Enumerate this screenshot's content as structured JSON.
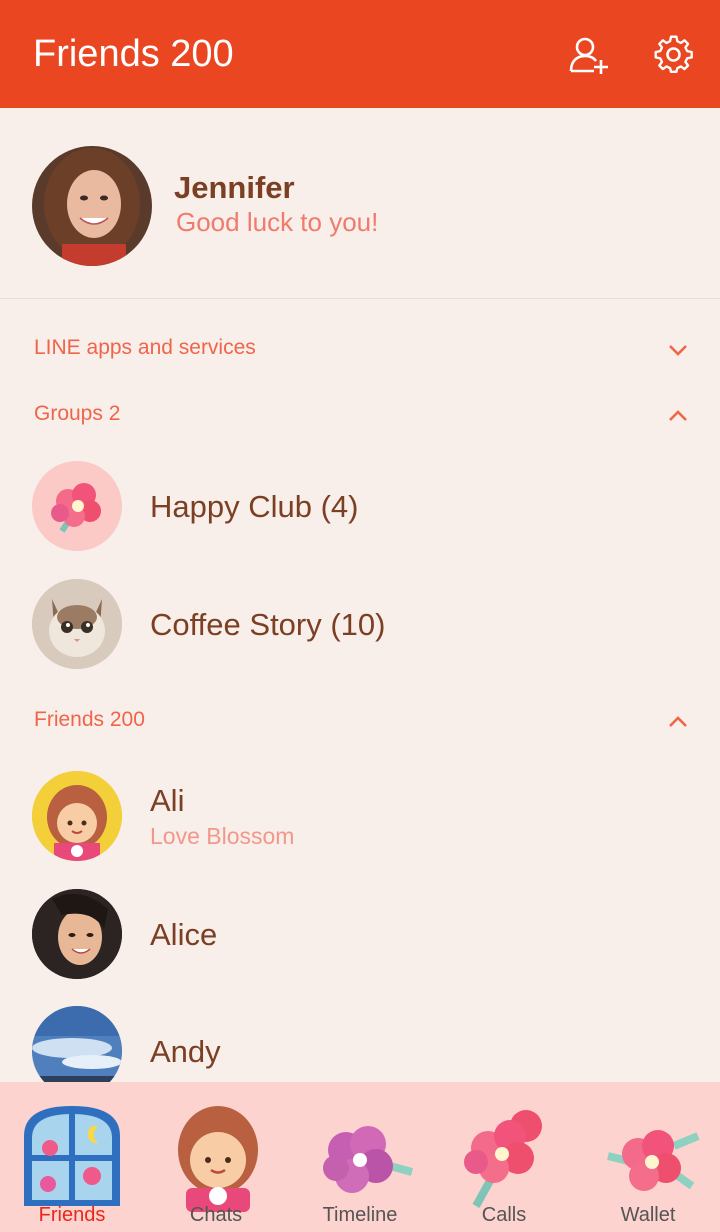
{
  "header": {
    "title": "Friends 200",
    "add_friend_icon": "add-friend-icon",
    "settings_icon": "gear-icon"
  },
  "profile": {
    "name": "Jennifer",
    "status": "Good luck to you!"
  },
  "sections": {
    "services": {
      "label": "LINE apps and services",
      "state": "collapsed"
    },
    "groups": {
      "label": "Groups 2",
      "state": "expanded"
    },
    "friends": {
      "label": "Friends 200",
      "state": "expanded"
    }
  },
  "groups": [
    {
      "name": "Happy Club (4)"
    },
    {
      "name": "Coffee Story (10)"
    }
  ],
  "friends": [
    {
      "name": "Ali",
      "status": "Love Blossom"
    },
    {
      "name": "Alice",
      "status": ""
    },
    {
      "name": "Andy",
      "status": ""
    }
  ],
  "tabs": [
    {
      "label": "Friends",
      "active": true
    },
    {
      "label": "Chats",
      "active": false
    },
    {
      "label": "Timeline",
      "active": false
    },
    {
      "label": "Calls",
      "active": false
    },
    {
      "label": "Wallet",
      "active": false
    }
  ],
  "colors": {
    "accent": "#ea4621",
    "background": "#f8eeea",
    "name_text": "#7b4024",
    "status_text": "#f07b6c",
    "tabbar": "#fdd3cf"
  }
}
